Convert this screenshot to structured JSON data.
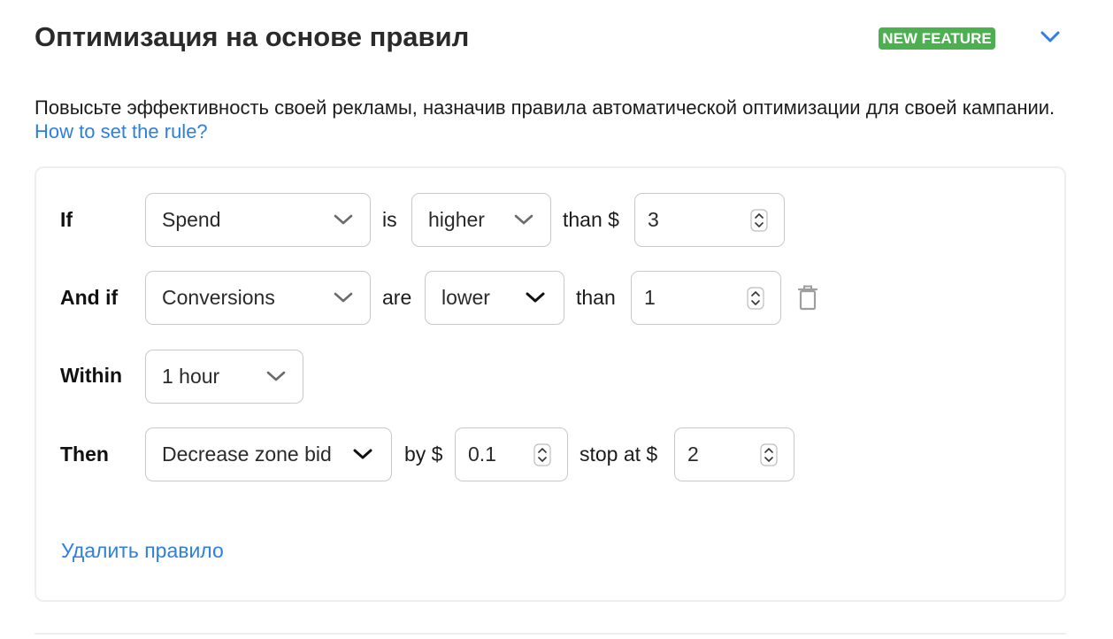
{
  "header": {
    "title": "Оптимизация на основе правил",
    "badge": "NEW FEATURE",
    "collapse_icon": "chevron-down-icon"
  },
  "description": {
    "text": "Повысьте эффективность своей рекламы, назначив правила автоматической оптимизации для своей кампании.",
    "link": "How to set the rule?"
  },
  "rule": {
    "if_row": {
      "label": "If",
      "metric": "Spend",
      "verb": "is",
      "comparison": "higher",
      "than": "than $",
      "value": "3"
    },
    "and_if_row": {
      "label": "And if",
      "metric": "Conversions",
      "verb": "are",
      "comparison": "lower",
      "than": "than",
      "value": "1"
    },
    "within_row": {
      "label": "Within",
      "period": "1 hour"
    },
    "then_row": {
      "label": "Then",
      "action": "Decrease zone bid",
      "by": "by $",
      "amount": "0.1",
      "stop": "stop at $",
      "stop_value": "2"
    },
    "delete_link": "Удалить правило"
  },
  "colors": {
    "accent": "#2d7fe0",
    "badge": "#4caf50",
    "border": "#c9c9c9"
  }
}
